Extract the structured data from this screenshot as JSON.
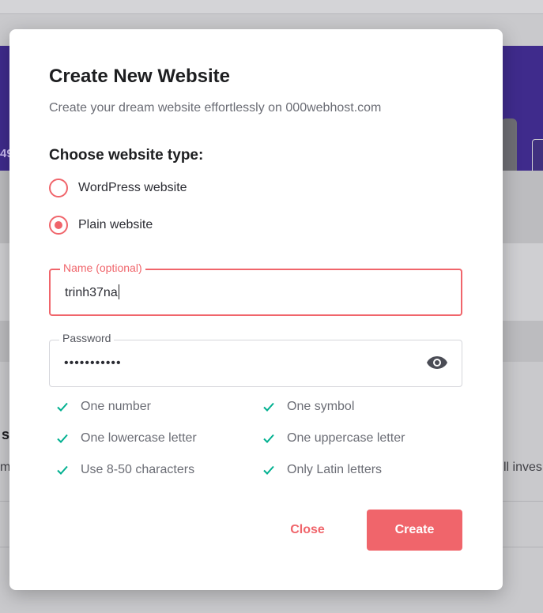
{
  "background": {
    "banner_fragment": "49",
    "heading_fragment": "s",
    "text_fragment_left": "m",
    "text_fragment_right": "ll inves"
  },
  "modal": {
    "title": "Create New Website",
    "subtitle": "Create your dream website effortlessly on 000webhost.com",
    "website_type": {
      "heading": "Choose website type:",
      "options": [
        {
          "label": "WordPress website",
          "selected": false
        },
        {
          "label": "Plain website",
          "selected": true
        }
      ]
    },
    "name_field": {
      "label": "Name (optional)",
      "value": "trinh37na"
    },
    "password_field": {
      "label": "Password",
      "value": "•••••••••••",
      "toggle_icon": "eye-icon"
    },
    "requirements": [
      {
        "label": "One number",
        "met": true
      },
      {
        "label": "One symbol",
        "met": true
      },
      {
        "label": "One lowercase letter",
        "met": true
      },
      {
        "label": "One uppercase letter",
        "met": true
      },
      {
        "label": "Use 8-50 characters",
        "met": true
      },
      {
        "label": "Only Latin letters",
        "met": true
      }
    ],
    "buttons": {
      "close": "Close",
      "create": "Create"
    }
  },
  "colors": {
    "accent": "#f0656b",
    "check": "#00b090",
    "banner": "#673de6"
  }
}
